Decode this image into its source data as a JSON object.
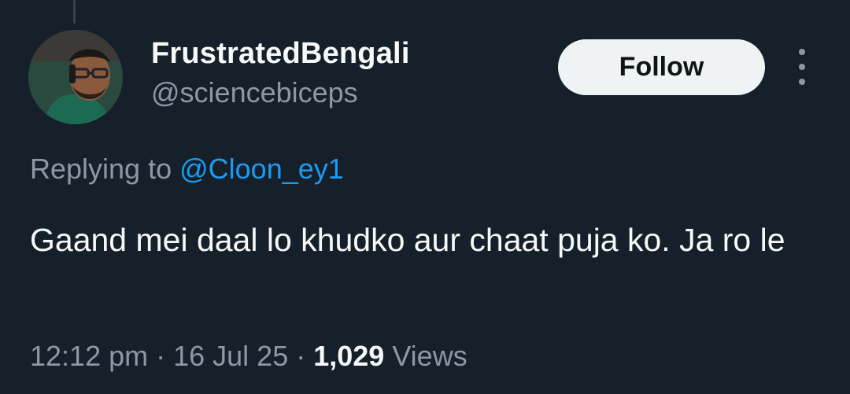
{
  "author": {
    "display_name": "FrustratedBengali",
    "handle": "@sciencebiceps"
  },
  "actions": {
    "follow_label": "Follow"
  },
  "reply": {
    "prefix": "Replying to ",
    "mention": "@Cloon_ey1"
  },
  "tweet": {
    "text": "Gaand mei daal lo khudko aur chaat puja ko. Ja ro le"
  },
  "meta": {
    "time": "12:12 pm",
    "separator": " · ",
    "date": "16 Jul 25",
    "views_count": "1,029",
    "views_label": " Views"
  },
  "colors": {
    "background": "#15202b",
    "text_primary": "#f7f9f9",
    "text_secondary": "#8b98a5",
    "link": "#1d9bf0",
    "follow_bg": "#eff3f4"
  },
  "icons": {
    "more": "more-vertical-icon"
  }
}
